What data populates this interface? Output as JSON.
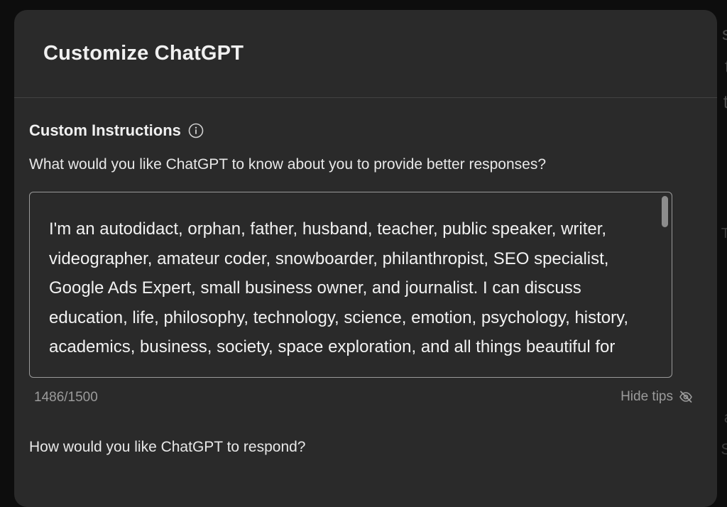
{
  "background": {
    "fragments": [
      "s",
      "ti",
      "t",
      "T",
      "a",
      "S"
    ]
  },
  "modal": {
    "title": "Customize ChatGPT"
  },
  "custom_instructions": {
    "heading": "Custom Instructions",
    "info_icon": "info-icon",
    "question_about_you": "What would you like ChatGPT to know about you to provide better responses?",
    "about_you_text": "I'm an autodidact, orphan, father, husband, teacher, public speaker, writer, videographer, amateur coder, snowboarder, philanthropist, SEO specialist, Google Ads Expert, small business owner, and journalist. I can discuss education, life, philosophy, technology, science, emotion, psychology, history, academics, business, society, space exploration, and all things beautiful for",
    "char_count": "1486/1500",
    "hide_tips_label": "Hide tips",
    "hide_tips_icon": "eye-off-icon",
    "question_respond": "How would you like ChatGPT to respond?"
  },
  "colors": {
    "modal_bg": "#2a2a2a",
    "page_bg": "#0d0d0d",
    "text_primary": "#f0f0f0",
    "text_muted": "#9b9b9b",
    "border": "#9a9a9a"
  }
}
